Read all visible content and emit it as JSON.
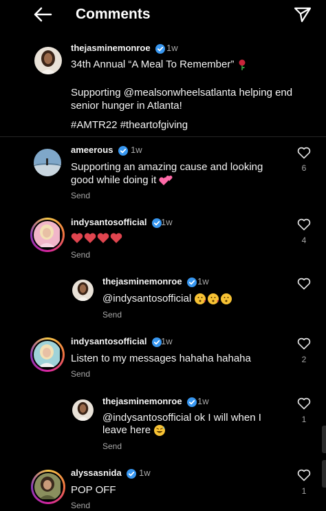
{
  "header": {
    "title": "Comments",
    "back_icon": "arrow-left-icon",
    "share_icon": "paper-plane-icon"
  },
  "caption": {
    "username": "thejasminemonroe",
    "time": "1w",
    "line1": "34th Annual “A Meal To Remember”",
    "line2": "Supporting @mealsonwheelsatlanta helping end",
    "line3": "senior hunger in Atlanta!",
    "hashtags": "#AMTR22 #theartofgiving"
  },
  "comments": [
    {
      "username": "ameerous",
      "time": "1w",
      "line1": "Supporting an amazing cause and looking",
      "line2": "good while doing it",
      "send": "Send",
      "likes": "6"
    },
    {
      "username": "indysantosofficial",
      "time": "1w",
      "line1": "",
      "send": "Send",
      "likes": "4"
    },
    {
      "username": "thejasminemonroe",
      "time": "1w",
      "line1": "@indysantosofficial",
      "send": "Send",
      "likes": ""
    },
    {
      "username": "indysantosofficial",
      "time": "1w",
      "line1": "Listen to my messages hahaha hahaha",
      "send": "Send",
      "likes": "2"
    },
    {
      "username": "thejasminemonroe",
      "time": "1w",
      "line1": "@indysantosofficial ok I will when I",
      "line2": "leave here",
      "send": "Send",
      "likes": "1"
    },
    {
      "username": "alyssasnida",
      "time": "1w",
      "line1": "POP OFF",
      "send": "Send",
      "likes": "1"
    }
  ],
  "colors": {
    "background": "#000000",
    "verified": "#3897f0",
    "muted": "#a8a8a8"
  }
}
